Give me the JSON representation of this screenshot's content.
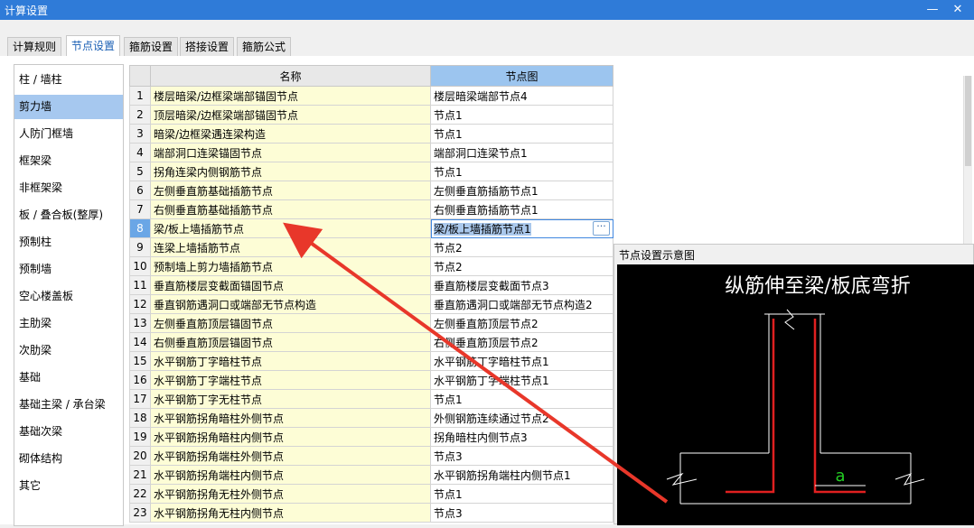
{
  "window": {
    "title": "计算设置",
    "minimize_glyph": "—",
    "close_glyph": "✕"
  },
  "tabs": [
    {
      "label": "计算规则",
      "active": false
    },
    {
      "label": "节点设置",
      "active": true
    },
    {
      "label": "箍筋设置",
      "active": false
    },
    {
      "label": "搭接设置",
      "active": false
    },
    {
      "label": "箍筋公式",
      "active": false
    }
  ],
  "sidebar": {
    "active_index": 1,
    "items": [
      "柱 / 墙柱",
      "剪力墙",
      "人防门框墙",
      "框架梁",
      "非框架梁",
      "板 / 叠合板(整厚)",
      "预制柱",
      "预制墙",
      "空心楼盖板",
      "主肋梁",
      "次肋梁",
      "基础",
      "基础主梁 / 承台梁",
      "基础次梁",
      "砌体结构",
      "其它"
    ]
  },
  "grid": {
    "headers": {
      "name": "名称",
      "diagram": "节点图"
    },
    "selected_row": 8,
    "ellipsis": "···",
    "rows": [
      {
        "num": "1",
        "name": "楼层暗梁/边框梁端部锚固节点",
        "node": "楼层暗梁端部节点4"
      },
      {
        "num": "2",
        "name": "顶层暗梁/边框梁端部锚固节点",
        "node": "节点1"
      },
      {
        "num": "3",
        "name": "暗梁/边框梁遇连梁构造",
        "node": "节点1"
      },
      {
        "num": "4",
        "name": "端部洞口连梁锚固节点",
        "node": "端部洞口连梁节点1"
      },
      {
        "num": "5",
        "name": "拐角连梁内侧钢筋节点",
        "node": "节点1"
      },
      {
        "num": "6",
        "name": "左侧垂直筋基础插筋节点",
        "node": "左侧垂直筋插筋节点1"
      },
      {
        "num": "7",
        "name": "右侧垂直筋基础插筋节点",
        "node": "右侧垂直筋插筋节点1"
      },
      {
        "num": "8",
        "name": "梁/板上墙插筋节点",
        "node": "梁/板上墙插筋节点1"
      },
      {
        "num": "9",
        "name": "连梁上墙插筋节点",
        "node": "节点2"
      },
      {
        "num": "10",
        "name": "预制墙上剪力墙插筋节点",
        "node": "节点2"
      },
      {
        "num": "11",
        "name": "垂直筋楼层变截面锚固节点",
        "node": "垂直筋楼层变截面节点3"
      },
      {
        "num": "12",
        "name": "垂直钢筋遇洞口或端部无节点构造",
        "node": "垂直筋遇洞口或端部无节点构造2"
      },
      {
        "num": "13",
        "name": "左侧垂直筋顶层锚固节点",
        "node": "左侧垂直筋顶层节点2"
      },
      {
        "num": "14",
        "name": "右侧垂直筋顶层锚固节点",
        "node": "右侧垂直筋顶层节点2"
      },
      {
        "num": "15",
        "name": "水平钢筋丁字暗柱节点",
        "node": "水平钢筋丁字暗柱节点1"
      },
      {
        "num": "16",
        "name": "水平钢筋丁字端柱节点",
        "node": "水平钢筋丁字端柱节点1"
      },
      {
        "num": "17",
        "name": "水平钢筋丁字无柱节点",
        "node": "节点1"
      },
      {
        "num": "18",
        "name": "水平钢筋拐角暗柱外侧节点",
        "node": "外侧钢筋连续通过节点2"
      },
      {
        "num": "19",
        "name": "水平钢筋拐角暗柱内侧节点",
        "node": "拐角暗柱内侧节点3"
      },
      {
        "num": "20",
        "name": "水平钢筋拐角端柱外侧节点",
        "node": "节点3"
      },
      {
        "num": "21",
        "name": "水平钢筋拐角端柱内侧节点",
        "node": "水平钢筋拐角端柱内侧节点1"
      },
      {
        "num": "22",
        "name": "水平钢筋拐角无柱外侧节点",
        "node": "节点1"
      },
      {
        "num": "23",
        "name": "水平钢筋拐角无柱内侧节点",
        "node": "节点3"
      }
    ]
  },
  "preview": {
    "title": "节点设置示意图",
    "diagram_caption": "纵筋伸至梁/板底弯折",
    "dimension_label": "a"
  },
  "colors": {
    "titlebar": "#2f7bd8",
    "selection": "#a6c8ef",
    "name_cell": "#fdfdd6",
    "header_highlight": "#9cc5ef",
    "arrow": "#e8372a",
    "rebar": "#e02020",
    "dimension": "#22cc22"
  },
  "icons": {
    "minimize": "minimize-icon",
    "close": "close-icon",
    "ellipsis": "ellipsis-button",
    "annotation": "arrow-annotation"
  }
}
